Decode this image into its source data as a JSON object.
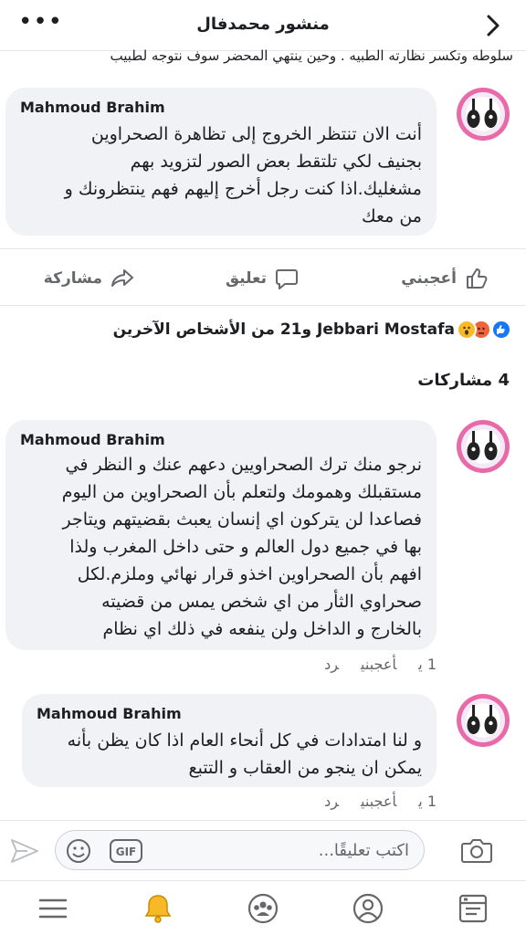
{
  "header": {
    "title": "منشور محمدفال",
    "more_glyph": "•••",
    "back_icon": "chevron-right-icon"
  },
  "cut_text": "سلوطه وتكسر نظارته الطبيه . وحين ينتهي المحضر سوف نتوجه لطبيب",
  "comments": [
    {
      "author": "Mahmoud Brahim",
      "lines": [
        "أنت الان تنتظر الخروج إلى تظاهرة الصحراوين",
        "بجنيف لكي تلتقط بعض الصور لتزويد بهم",
        "مشغليك.اذا كنت رجل أخرج إليهم فهم ينتظرونك و",
        "من معك"
      ]
    },
    {
      "author": "Mahmoud Brahim",
      "lines": [
        "نرجو منك ترك الصحراويين دعهم عنك و النظر في",
        "مستقبلك وهمومك ولتعلم بأن الصحراوين من اليوم",
        "فصاعدا لن يتركون اي إنسان يعبث بقضيتهم ويتاجر",
        "بها في جميع دول العالم و حتى داخل المغرب ولذا",
        "افهم بأن الصحراوين اخذو قرار نهائي وملزم.لكل",
        "صحراوي الثأر من اي شخص يمس من قضيته",
        "بالخارج و الداخل ولن ينفعه في ذلك اي نظام"
      ],
      "time": "1 ي",
      "like": "أعجبني",
      "reply": "رد"
    },
    {
      "author": "Mahmoud Brahim",
      "lines": [
        "و لنا امتدادات في كل أنحاء العام اذا كان يظن بأنه",
        "يمكن ان ينجو من العقاب و التتبع"
      ],
      "time": "1 ي",
      "like": "أعجبني",
      "reply": "رد"
    }
  ],
  "actions": {
    "like": "أعجبني",
    "comment": "تعليق",
    "share": "مشاركة"
  },
  "reactions": {
    "summary": "Jebbari Mostafa و21 من الأشخاص الآخرين",
    "icons": [
      "like-reaction-icon",
      "angry-reaction-icon",
      "wow-reaction-icon"
    ],
    "colors": {
      "like": "#1877f2",
      "angry": "#f0643c",
      "wow": "#f7b928"
    }
  },
  "shares": "4 مشاركات",
  "composer": {
    "placeholder": "اكتب تعليقًا...",
    "gif_label": "GIF"
  },
  "bottom_nav": [
    "menu-icon",
    "notifications-icon",
    "groups-icon",
    "profile-icon",
    "feed-icon"
  ],
  "colors": {
    "accent": "#1877f2",
    "bubble": "#f0f2f5",
    "muted": "#65676b",
    "bell": "#f7b928"
  }
}
